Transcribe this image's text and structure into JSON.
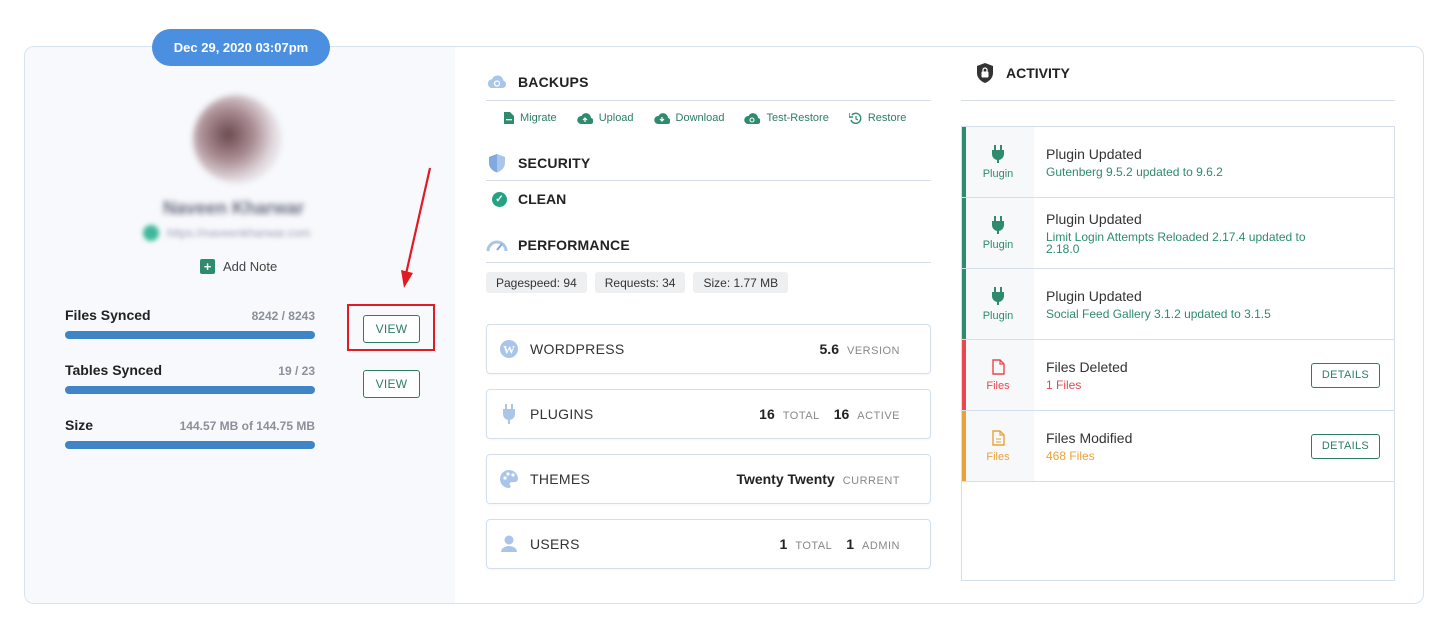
{
  "date_pill": "Dec 29, 2020 03:07pm",
  "profile": {
    "name": "Naveen Kharwar",
    "email": "https://naveenkharwar.com"
  },
  "add_note": "Add Note",
  "stats": [
    {
      "label": "Files Synced",
      "value": "8242 / 8243",
      "progress": 0.999
    },
    {
      "label": "Tables Synced",
      "value": "19 / 23",
      "progress": 1.0
    },
    {
      "label": "Size",
      "value": "144.57 MB of 144.75 MB",
      "progress": 0.999
    }
  ],
  "view_buttons": [
    "VIEW",
    "VIEW"
  ],
  "backups": {
    "title": "BACKUPS",
    "actions": [
      {
        "label": "Migrate",
        "icon": "file-icon"
      },
      {
        "label": "Upload",
        "icon": "cloud-upload-icon"
      },
      {
        "label": "Download",
        "icon": "cloud-download-icon"
      },
      {
        "label": "Test-Restore",
        "icon": "cloud-sync-icon"
      },
      {
        "label": "Restore",
        "icon": "restore-icon"
      }
    ]
  },
  "security": {
    "title": "SECURITY",
    "status": "CLEAN"
  },
  "performance": {
    "title": "PERFORMANCE",
    "chips": [
      "Pagespeed: 94",
      "Requests: 34",
      "Size: 1.77 MB"
    ]
  },
  "wordpress": {
    "title": "WORDPRESS",
    "version": "5.6",
    "version_label": "VERSION"
  },
  "plugins": {
    "title": "PLUGINS",
    "total": "16",
    "total_label": "TOTAL",
    "active": "16",
    "active_label": "ACTIVE"
  },
  "themes": {
    "title": "THEMES",
    "current": "Twenty Twenty",
    "current_label": "CURRENT"
  },
  "users": {
    "title": "USERS",
    "total": "1",
    "total_label": "TOTAL",
    "admin": "1",
    "admin_label": "ADMIN"
  },
  "activity": {
    "title": "ACTIVITY",
    "items": [
      {
        "type": "Plugin",
        "title": "Plugin Updated",
        "detail": "Gutenberg 9.5.2 updated to 9.6.2",
        "color": "#2e8b6e"
      },
      {
        "type": "Plugin",
        "title": "Plugin Updated",
        "detail": "Limit Login Attempts Reloaded 2.17.4 updated to 2.18.0",
        "color": "#2e8b6e"
      },
      {
        "type": "Plugin",
        "title": "Plugin Updated",
        "detail": "Social Feed Gallery 3.1.2 updated to 3.1.5",
        "color": "#2e8b6e"
      },
      {
        "type": "Files",
        "title": "Files Deleted",
        "detail": "1 Files",
        "color": "#e8474f",
        "button": "DETAILS"
      },
      {
        "type": "Files",
        "title": "Files Modified",
        "detail": "468 Files",
        "color": "#e9a23b",
        "button": "DETAILS"
      }
    ]
  }
}
